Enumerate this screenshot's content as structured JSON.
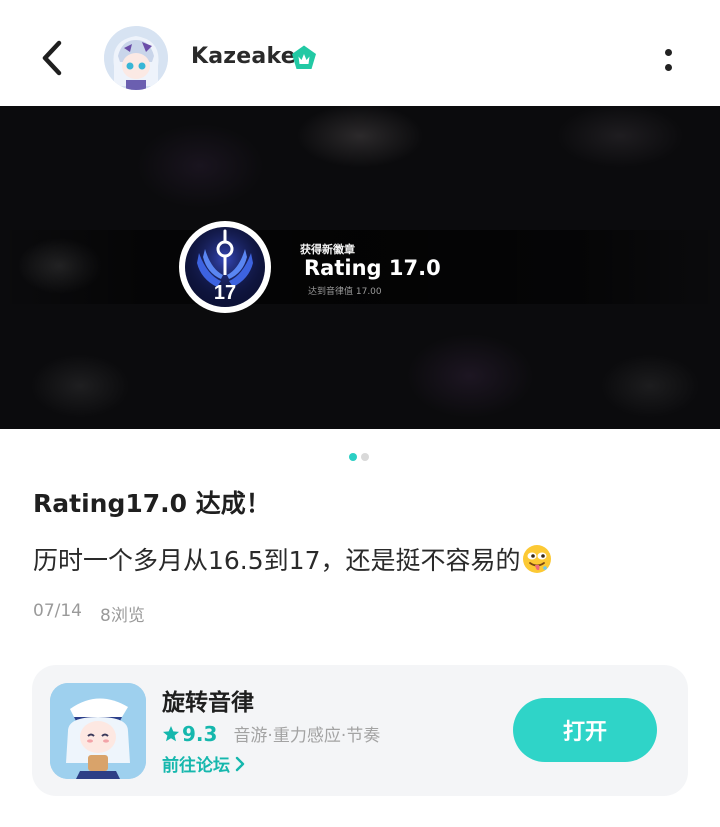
{
  "header": {
    "username": "Kazeake",
    "icons": {
      "back": "chevron-left-icon",
      "more": "more-vertical-icon",
      "badge": "vip-badge-icon"
    }
  },
  "banner": {
    "medal_number": "17",
    "kicker": "获得新徽章",
    "title": "Rating 17.0",
    "subtitle": "达到音律值 17.00",
    "pager": {
      "total": 2,
      "active": 1
    }
  },
  "post": {
    "title": "Rating17.0 达成！",
    "body": "历时一个多月从16.5到17，还是挺不容易的",
    "emoji": "drooling-face-emoji",
    "date": "07/14",
    "views": "8浏览"
  },
  "app_card": {
    "name": "旋转音律",
    "rating": "9.3",
    "tags": "音游·重力感应·节奏",
    "forum_link": "前往论坛",
    "open_button": "打开",
    "accent_color": "#2fd4c8"
  }
}
